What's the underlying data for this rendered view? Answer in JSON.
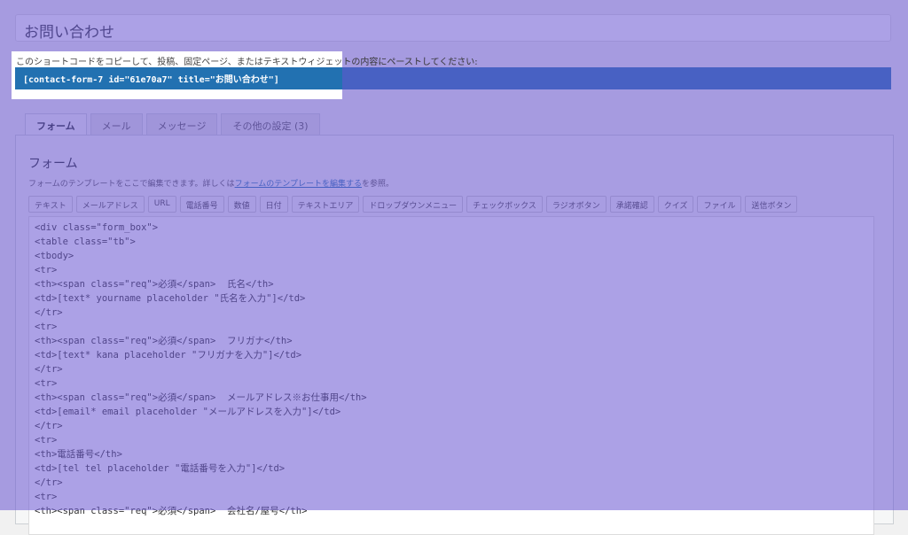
{
  "form_title": "お問い合わせ",
  "shortcode": {
    "hint": "このショートコードをコピーして、投稿、固定ページ、またはテキストウィジェットの内容にペーストしてください:",
    "code": "[contact-form-7 id=\"61e70a7\" title=\"お問い合わせ\"]"
  },
  "tabs": [
    {
      "label": "フォーム"
    },
    {
      "label": "メール"
    },
    {
      "label": "メッセージ"
    },
    {
      "label": "その他の設定 (3)"
    }
  ],
  "panel": {
    "heading": "フォーム",
    "desc_prefix": "フォームのテンプレートをここで編集できます。詳しくは",
    "desc_link": "フォームのテンプレートを編集する",
    "desc_suffix": "を参照。"
  },
  "tag_buttons": [
    "テキスト",
    "メールアドレス",
    "URL",
    "電話番号",
    "数値",
    "日付",
    "テキストエリア",
    "ドロップダウンメニュー",
    "チェックボックス",
    "ラジオボタン",
    "承諾確認",
    "クイズ",
    "ファイル",
    "送信ボタン"
  ],
  "code_lines": [
    "<div class=\"form_box\">",
    "<table class=\"tb\">",
    "<tbody>",
    "<tr>",
    "<th><span class=\"req\">必須</span>  氏名</th>",
    "<td>[text* yourname placeholder \"氏名を入力\"]</td>",
    "</tr>",
    "<tr>",
    "<th><span class=\"req\">必須</span>  フリガナ</th>",
    "<td>[text* kana placeholder \"フリガナを入力\"]</td>",
    "</tr>",
    "<tr>",
    "<th><span class=\"req\">必須</span>  メールアドレス※お仕事用</th>",
    "<td>[email* email placeholder \"メールアドレスを入力\"]</td>",
    "</tr>",
    "<tr>",
    "<th>電話番号</th>",
    "<td>[tel tel placeholder \"電話番号を入力\"]</td>",
    "</tr>",
    "<tr>",
    "<th><span class=\"req\">必須</span>  会社名/屋号</th>"
  ],
  "colors": {
    "overlay": "#6854d2",
    "shortcode_bg": "#2271b1",
    "link": "#2271b1"
  }
}
